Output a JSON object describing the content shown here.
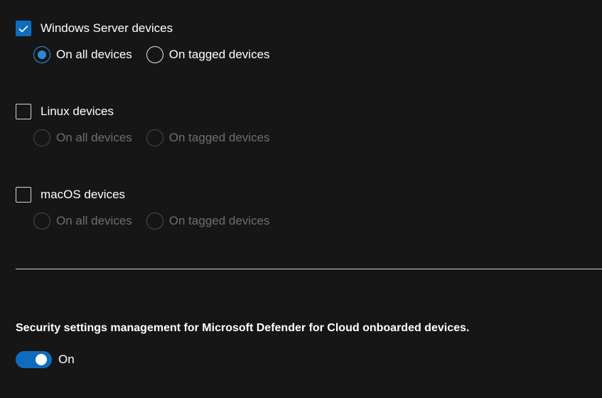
{
  "groups": [
    {
      "label": "Windows Server devices",
      "checked": true,
      "options": [
        "On all devices",
        "On tagged devices"
      ],
      "selected_option": "On all devices",
      "options_enabled": true
    },
    {
      "label": "Linux devices",
      "checked": false,
      "options": [
        "On all devices",
        "On tagged devices"
      ],
      "selected_option": null,
      "options_enabled": false
    },
    {
      "label": "macOS devices",
      "checked": false,
      "options": [
        "On all devices",
        "On tagged devices"
      ],
      "selected_option": null,
      "options_enabled": false
    }
  ],
  "security_settings": {
    "title": "Security settings management for Microsoft Defender for Cloud onboarded devices.",
    "toggle_state": "On",
    "enabled": true
  },
  "icons": {
    "checkmark": "checkmark-icon"
  },
  "colors": {
    "accent": "#0f6cbd",
    "radio_dot": "#2b88d8",
    "background": "#161616",
    "disabled_text": "#6e6e6e"
  }
}
